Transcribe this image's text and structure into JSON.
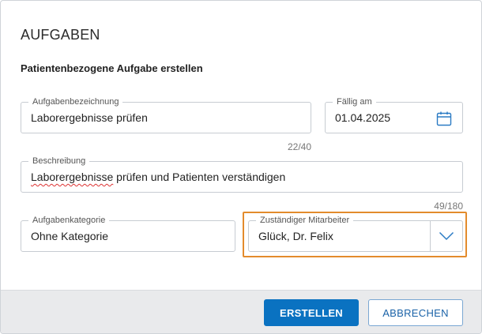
{
  "dialog": {
    "title": "AUFGABEN",
    "subtitle": "Patientenbezogene Aufgabe erstellen"
  },
  "fields": {
    "bezeichnung": {
      "label": "Aufgabenbezeichnung",
      "value": "Laborergebnisse prüfen",
      "counter": "22/40"
    },
    "faellig": {
      "label": "Fällig am",
      "value": "01.04.2025"
    },
    "beschreibung": {
      "label": "Beschreibung",
      "value_first_word": "Laborergebnisse",
      "value_rest": " prüfen und Patienten verständigen",
      "counter": "49/180"
    },
    "kategorie": {
      "label": "Aufgabenkategorie",
      "value": "Ohne Kategorie"
    },
    "mitarbeiter": {
      "label": "Zuständiger Mitarbeiter",
      "value": "Glück, Dr. Felix"
    }
  },
  "buttons": {
    "create": "ERSTELLEN",
    "cancel": "ABBRECHEN"
  },
  "colors": {
    "primary": "#0a72c1",
    "highlight": "#e38b2c",
    "icon": "#2b7bc4"
  },
  "icons": {
    "calendar": "calendar-icon",
    "dropdown": "chevron-down-icon"
  }
}
